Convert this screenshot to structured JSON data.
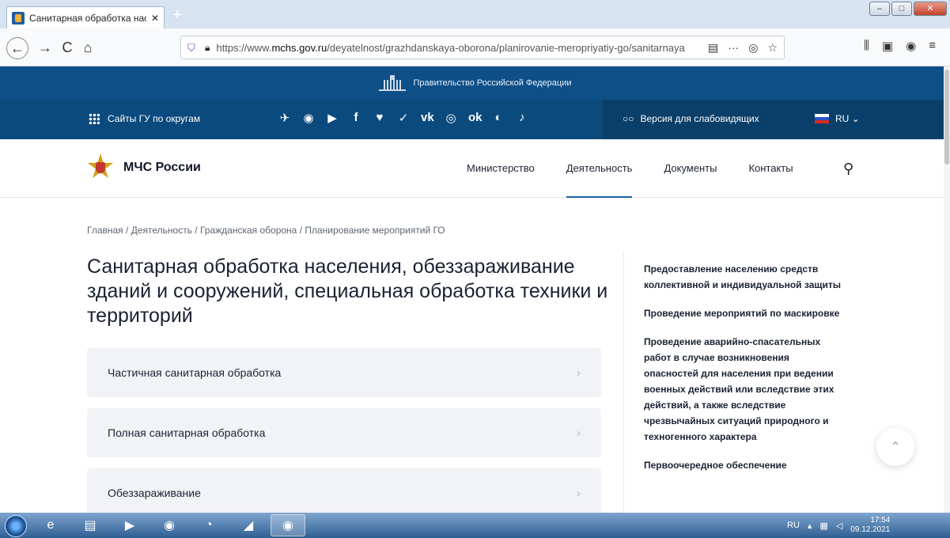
{
  "browser": {
    "tab_title": "Санитарная обработка населения",
    "tab_close": "✕",
    "new_tab": "+",
    "back": "←",
    "forward": "→",
    "reload": "C",
    "home": "⌂",
    "url_prefix": "https://www.",
    "url_domain": "mchs.gov.ru",
    "url_path": "/deyatelnost/grazhdanskaya-oborona/planirovanie-meropriyatiy-go/sanitarnaya",
    "url_tools": [
      "▤",
      "···",
      "◎",
      "☆"
    ],
    "right_tools": [
      "⫼",
      "▣",
      "◉",
      "≡"
    ]
  },
  "gov_banner": {
    "text": "Правительство Российской Федерации"
  },
  "top_bar": {
    "sites_label": "Сайты ГУ по округам",
    "socials": [
      "✈",
      "◉",
      "▶",
      "f",
      "♥",
      "✓",
      "vk",
      "◎",
      "ok",
      "◐",
      "♪"
    ],
    "accessibility_label": "Версия для слабовидящих",
    "accessibility_icon": "○○",
    "language": "RU ⌄"
  },
  "header": {
    "logo_text": "МЧС России",
    "menu": [
      "Министерство",
      "Деятельность",
      "Документы",
      "Контакты"
    ],
    "active_index": 1,
    "search_icon": "⚲"
  },
  "breadcrumbs": [
    "Главная",
    "Деятельность",
    "Гражданская оборона",
    "Планирование мероприятий ГО"
  ],
  "page_title": "Санитарная обработка населения, обеззараживание зданий и сооружений, специальная обработка техники и территорий",
  "cards": [
    {
      "label": "Частичная санитарная обработка",
      "chevron": "›"
    },
    {
      "label": "Полная санитарная обработка",
      "chevron": "›"
    },
    {
      "label": "Обеззараживание",
      "chevron": "›"
    }
  ],
  "sidebar": [
    "Предоставление населению средств коллективной и индивидуальной защиты",
    "Проведение мероприятий по маскировке",
    "Проведение аварийно-спасательных работ в случае возникновения опасностей для населения при ведении военных действий или вследствие этих действий, а также вследствие чрезвычайных ситуаций природного и техногенного характера",
    "Первоочередное обеспечение"
  ],
  "to_top": "⌃",
  "taskbar": {
    "apps": [
      "e",
      "▤",
      "▶",
      "◉",
      "◔",
      "◢",
      "◉"
    ],
    "lang": "RU",
    "time": "17:54",
    "date": "09.12.2021"
  }
}
